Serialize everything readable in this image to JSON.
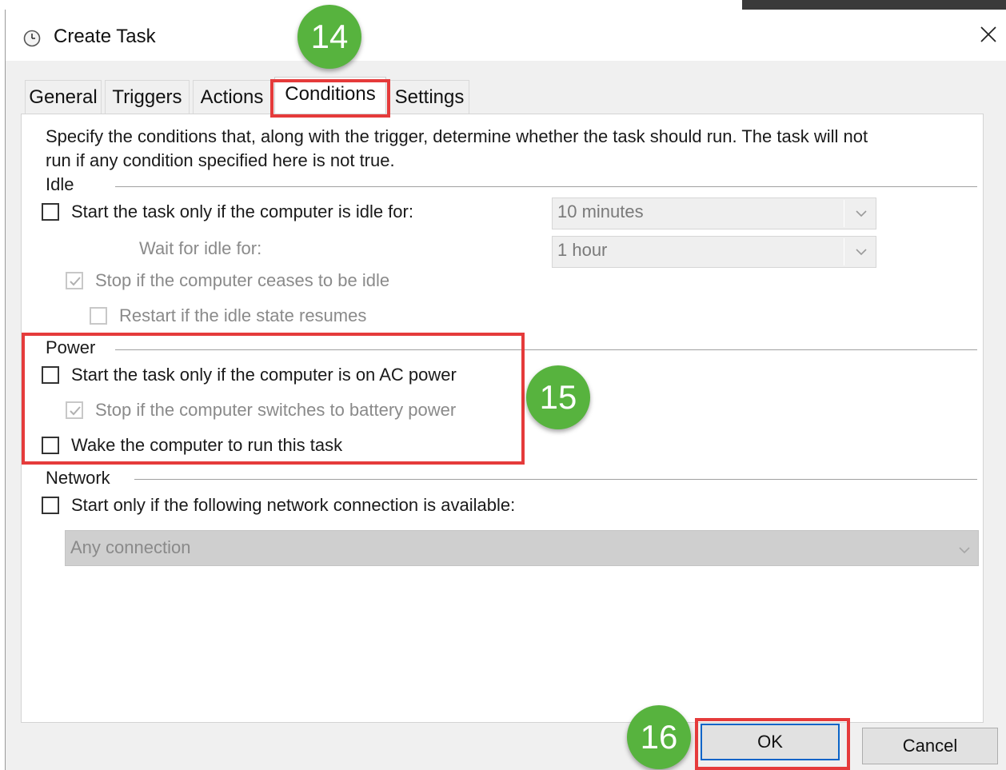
{
  "window": {
    "title": "Create Task",
    "icon": "clock-icon",
    "close_icon": "close-icon"
  },
  "tabs": [
    {
      "label": "General"
    },
    {
      "label": "Triggers"
    },
    {
      "label": "Actions"
    },
    {
      "label": "Conditions",
      "active": true
    },
    {
      "label": "Settings"
    }
  ],
  "description_line1": "Specify the conditions that, along with the trigger, determine whether the task should run.  The task will not",
  "description_line2": "run  if any condition specified here is not true.",
  "idle": {
    "group_label": "Idle",
    "start_if_idle": {
      "label": "Start the task only if the computer is idle for:",
      "checked": false
    },
    "idle_duration": "10 minutes",
    "wait_label": "Wait for idle for:",
    "wait_duration": "1 hour",
    "stop_if_ceases": {
      "label": "Stop if the computer ceases to be idle",
      "checked": true,
      "enabled": false
    },
    "restart_if_resumes": {
      "label": "Restart if the idle state resumes",
      "checked": false,
      "enabled": false
    }
  },
  "power": {
    "group_label": "Power",
    "ac_power": {
      "label": "Start the task only if the computer is on AC power",
      "checked": false
    },
    "battery": {
      "label": "Stop if the computer switches to battery power",
      "checked": true,
      "enabled": false
    },
    "wake": {
      "label": "Wake the computer to run this task",
      "checked": false
    }
  },
  "network": {
    "group_label": "Network",
    "start_only_if": {
      "label": "Start only if the following network connection is available:",
      "checked": false
    },
    "connection": "Any connection"
  },
  "buttons": {
    "ok": "OK",
    "cancel": "Cancel"
  },
  "annotations": {
    "badge_14": "14",
    "badge_15": "15",
    "badge_16": "16",
    "badge_color": "#57b33e",
    "highlight_color": "#e53b3b"
  }
}
